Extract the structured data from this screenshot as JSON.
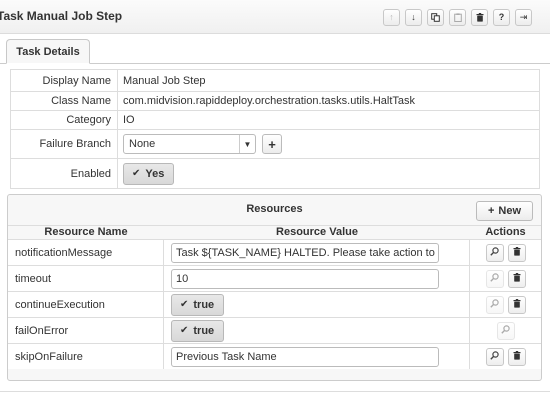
{
  "title": "Task Manual Job Step",
  "toolbar": {
    "buttons": [
      {
        "name": "move-up-icon",
        "glyph": "↑",
        "disabled": true
      },
      {
        "name": "move-down-icon",
        "glyph": "↓",
        "disabled": false
      },
      {
        "name": "copy-icon",
        "glyph": "copy",
        "disabled": false
      },
      {
        "name": "paste-icon",
        "glyph": "paste",
        "disabled": true
      },
      {
        "name": "delete-icon",
        "glyph": "trash",
        "disabled": false
      },
      {
        "name": "help-icon",
        "glyph": "?",
        "disabled": false
      },
      {
        "name": "collapse-icon",
        "glyph": "⇥",
        "disabled": false
      }
    ]
  },
  "tab": {
    "label": "Task Details"
  },
  "details": {
    "display_name_label": "Display Name",
    "display_name_value": "Manual Job Step",
    "class_name_label": "Class Name",
    "class_name_value": "com.midvision.rapiddeploy.orchestration.tasks.utils.HaltTask",
    "category_label": "Category",
    "category_value": "IO",
    "failure_branch_label": "Failure Branch",
    "failure_branch_value": "None",
    "enabled_label": "Enabled",
    "enabled_value": "Yes"
  },
  "resources": {
    "title": "Resources",
    "new_label": "New",
    "columns": {
      "name": "Resource Name",
      "value": "Resource Value",
      "actions": "Actions"
    },
    "rows": [
      {
        "name": "notificationMessage",
        "type": "text",
        "value": "Task ${TASK_NAME} HALTED.  Please take action to con",
        "search": true,
        "trash": true
      },
      {
        "name": "timeout",
        "type": "text",
        "value": "10",
        "search": false,
        "trash": true
      },
      {
        "name": "continueExecution",
        "type": "toggle",
        "value": "true",
        "search": false,
        "trash": true
      },
      {
        "name": "failOnError",
        "type": "toggle",
        "value": "true",
        "search": false,
        "trash": false
      },
      {
        "name": "skipOnFailure",
        "type": "text",
        "value": "Previous Task Name",
        "search": true,
        "trash": true
      }
    ]
  },
  "colors": {
    "border": "#dddddd",
    "panel_bg": "#f7f7f7",
    "text": "#333333"
  }
}
